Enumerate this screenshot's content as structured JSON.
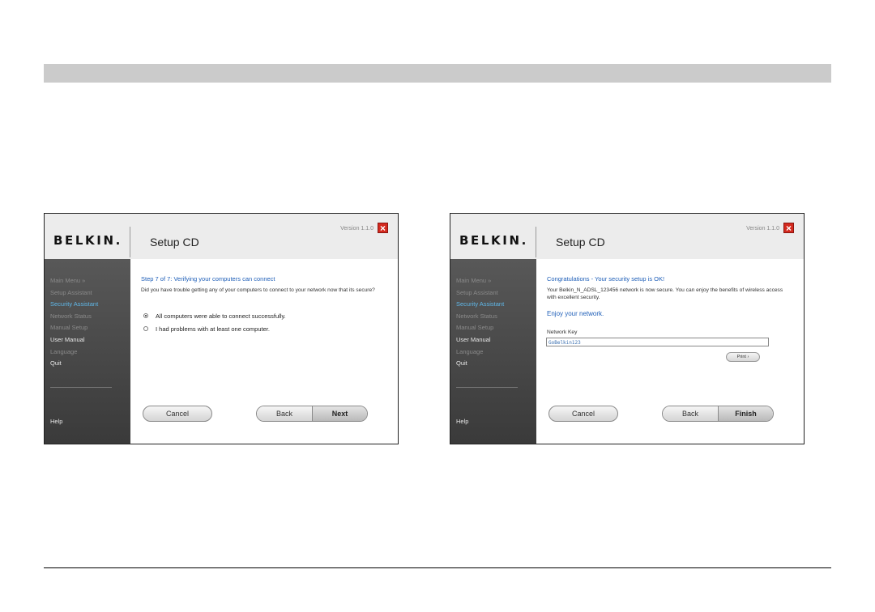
{
  "left_window": {
    "brand": "BELKIN.",
    "title": "Setup CD",
    "version": "Version 1.1.0",
    "close_icon": "close-icon",
    "sidebar": {
      "items": [
        {
          "label": "Main Menu  »",
          "state": "dim"
        },
        {
          "label": "Setup Assistant",
          "state": "dim"
        },
        {
          "label": "Security Assistant",
          "state": "active"
        },
        {
          "label": "Network Status",
          "state": "dim"
        },
        {
          "label": "Manual Setup",
          "state": "dim"
        },
        {
          "label": "User Manual",
          "state": "bright"
        },
        {
          "label": "Language",
          "state": "dim"
        },
        {
          "label": "Quit",
          "state": "bright"
        }
      ],
      "help": "Help"
    },
    "content": {
      "heading": "Step 7 of 7: Verifying your computers can connect",
      "question": "Did you have trouble getting any of your computers to connect to your network now that its secure?",
      "options": [
        {
          "label": "All computers were able to connect successfully.",
          "selected": true
        },
        {
          "label": "I had problems with at least one computer.",
          "selected": false
        }
      ]
    },
    "buttons": {
      "cancel": "Cancel",
      "back": "Back",
      "next": "Next"
    }
  },
  "right_window": {
    "brand": "BELKIN.",
    "title": "Setup CD",
    "version": "Version 1.1.0",
    "close_icon": "close-icon",
    "sidebar": {
      "items": [
        {
          "label": "Main Menu  »",
          "state": "dim"
        },
        {
          "label": "Setup Assistant",
          "state": "dim"
        },
        {
          "label": "Security Assistant",
          "state": "active"
        },
        {
          "label": "Network Status",
          "state": "dim"
        },
        {
          "label": "Manual Setup",
          "state": "dim"
        },
        {
          "label": "User Manual",
          "state": "bright"
        },
        {
          "label": "Language",
          "state": "dim"
        },
        {
          "label": "Quit",
          "state": "bright"
        }
      ],
      "help": "Help"
    },
    "content": {
      "heading": "Congratulations - Your security setup is OK!",
      "text": "Your Belkin_N_ADSL_123456 network is now secure. You can enjoy the benefits of wireless access with excellent security.",
      "enjoy": "Enjoy your network.",
      "network_key_label": "Network Key",
      "network_key_value": "GoBelkin123",
      "print_label": "Print ›"
    },
    "buttons": {
      "cancel": "Cancel",
      "back": "Back",
      "finish": "Finish"
    }
  },
  "colors": {
    "accent_blue": "#1f5fb8",
    "sidebar_active": "#5fb7e8",
    "close_red": "#d42a1f",
    "header_bar": "#cbcbcb"
  }
}
